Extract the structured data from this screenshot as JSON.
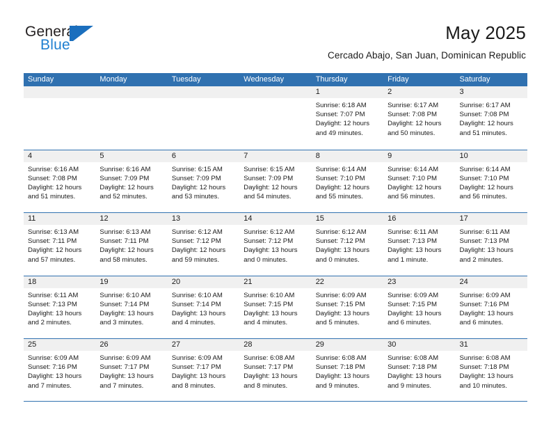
{
  "brand": {
    "name_part1": "General",
    "name_part2": "Blue",
    "logo_icon": "general-blue-triangle-logo"
  },
  "header": {
    "title": "May 2025",
    "subtitle": "Cercado Abajo, San Juan, Dominican Republic"
  },
  "colors": {
    "header_blue": "#3071b0",
    "brand_blue": "#1f7fd0",
    "day_band_gray": "#f0f0f0",
    "text": "#1a1a1a"
  },
  "calendar": {
    "weekday_headers": [
      "Sunday",
      "Monday",
      "Tuesday",
      "Wednesday",
      "Thursday",
      "Friday",
      "Saturday"
    ],
    "weeks": [
      [
        {
          "day": "",
          "empty": true,
          "sunrise": "",
          "sunset": "",
          "daylight_line1": "",
          "daylight_line2": ""
        },
        {
          "day": "",
          "empty": true,
          "sunrise": "",
          "sunset": "",
          "daylight_line1": "",
          "daylight_line2": ""
        },
        {
          "day": "",
          "empty": true,
          "sunrise": "",
          "sunset": "",
          "daylight_line1": "",
          "daylight_line2": ""
        },
        {
          "day": "",
          "empty": true,
          "sunrise": "",
          "sunset": "",
          "daylight_line1": "",
          "daylight_line2": ""
        },
        {
          "day": "1",
          "empty": false,
          "sunrise": "Sunrise: 6:18 AM",
          "sunset": "Sunset: 7:07 PM",
          "daylight_line1": "Daylight: 12 hours",
          "daylight_line2": "and 49 minutes."
        },
        {
          "day": "2",
          "empty": false,
          "sunrise": "Sunrise: 6:17 AM",
          "sunset": "Sunset: 7:08 PM",
          "daylight_line1": "Daylight: 12 hours",
          "daylight_line2": "and 50 minutes."
        },
        {
          "day": "3",
          "empty": false,
          "sunrise": "Sunrise: 6:17 AM",
          "sunset": "Sunset: 7:08 PM",
          "daylight_line1": "Daylight: 12 hours",
          "daylight_line2": "and 51 minutes."
        }
      ],
      [
        {
          "day": "4",
          "empty": false,
          "sunrise": "Sunrise: 6:16 AM",
          "sunset": "Sunset: 7:08 PM",
          "daylight_line1": "Daylight: 12 hours",
          "daylight_line2": "and 51 minutes."
        },
        {
          "day": "5",
          "empty": false,
          "sunrise": "Sunrise: 6:16 AM",
          "sunset": "Sunset: 7:09 PM",
          "daylight_line1": "Daylight: 12 hours",
          "daylight_line2": "and 52 minutes."
        },
        {
          "day": "6",
          "empty": false,
          "sunrise": "Sunrise: 6:15 AM",
          "sunset": "Sunset: 7:09 PM",
          "daylight_line1": "Daylight: 12 hours",
          "daylight_line2": "and 53 minutes."
        },
        {
          "day": "7",
          "empty": false,
          "sunrise": "Sunrise: 6:15 AM",
          "sunset": "Sunset: 7:09 PM",
          "daylight_line1": "Daylight: 12 hours",
          "daylight_line2": "and 54 minutes."
        },
        {
          "day": "8",
          "empty": false,
          "sunrise": "Sunrise: 6:14 AM",
          "sunset": "Sunset: 7:10 PM",
          "daylight_line1": "Daylight: 12 hours",
          "daylight_line2": "and 55 minutes."
        },
        {
          "day": "9",
          "empty": false,
          "sunrise": "Sunrise: 6:14 AM",
          "sunset": "Sunset: 7:10 PM",
          "daylight_line1": "Daylight: 12 hours",
          "daylight_line2": "and 56 minutes."
        },
        {
          "day": "10",
          "empty": false,
          "sunrise": "Sunrise: 6:14 AM",
          "sunset": "Sunset: 7:10 PM",
          "daylight_line1": "Daylight: 12 hours",
          "daylight_line2": "and 56 minutes."
        }
      ],
      [
        {
          "day": "11",
          "empty": false,
          "sunrise": "Sunrise: 6:13 AM",
          "sunset": "Sunset: 7:11 PM",
          "daylight_line1": "Daylight: 12 hours",
          "daylight_line2": "and 57 minutes."
        },
        {
          "day": "12",
          "empty": false,
          "sunrise": "Sunrise: 6:13 AM",
          "sunset": "Sunset: 7:11 PM",
          "daylight_line1": "Daylight: 12 hours",
          "daylight_line2": "and 58 minutes."
        },
        {
          "day": "13",
          "empty": false,
          "sunrise": "Sunrise: 6:12 AM",
          "sunset": "Sunset: 7:12 PM",
          "daylight_line1": "Daylight: 12 hours",
          "daylight_line2": "and 59 minutes."
        },
        {
          "day": "14",
          "empty": false,
          "sunrise": "Sunrise: 6:12 AM",
          "sunset": "Sunset: 7:12 PM",
          "daylight_line1": "Daylight: 13 hours",
          "daylight_line2": "and 0 minutes."
        },
        {
          "day": "15",
          "empty": false,
          "sunrise": "Sunrise: 6:12 AM",
          "sunset": "Sunset: 7:12 PM",
          "daylight_line1": "Daylight: 13 hours",
          "daylight_line2": "and 0 minutes."
        },
        {
          "day": "16",
          "empty": false,
          "sunrise": "Sunrise: 6:11 AM",
          "sunset": "Sunset: 7:13 PM",
          "daylight_line1": "Daylight: 13 hours",
          "daylight_line2": "and 1 minute."
        },
        {
          "day": "17",
          "empty": false,
          "sunrise": "Sunrise: 6:11 AM",
          "sunset": "Sunset: 7:13 PM",
          "daylight_line1": "Daylight: 13 hours",
          "daylight_line2": "and 2 minutes."
        }
      ],
      [
        {
          "day": "18",
          "empty": false,
          "sunrise": "Sunrise: 6:11 AM",
          "sunset": "Sunset: 7:13 PM",
          "daylight_line1": "Daylight: 13 hours",
          "daylight_line2": "and 2 minutes."
        },
        {
          "day": "19",
          "empty": false,
          "sunrise": "Sunrise: 6:10 AM",
          "sunset": "Sunset: 7:14 PM",
          "daylight_line1": "Daylight: 13 hours",
          "daylight_line2": "and 3 minutes."
        },
        {
          "day": "20",
          "empty": false,
          "sunrise": "Sunrise: 6:10 AM",
          "sunset": "Sunset: 7:14 PM",
          "daylight_line1": "Daylight: 13 hours",
          "daylight_line2": "and 4 minutes."
        },
        {
          "day": "21",
          "empty": false,
          "sunrise": "Sunrise: 6:10 AM",
          "sunset": "Sunset: 7:15 PM",
          "daylight_line1": "Daylight: 13 hours",
          "daylight_line2": "and 4 minutes."
        },
        {
          "day": "22",
          "empty": false,
          "sunrise": "Sunrise: 6:09 AM",
          "sunset": "Sunset: 7:15 PM",
          "daylight_line1": "Daylight: 13 hours",
          "daylight_line2": "and 5 minutes."
        },
        {
          "day": "23",
          "empty": false,
          "sunrise": "Sunrise: 6:09 AM",
          "sunset": "Sunset: 7:15 PM",
          "daylight_line1": "Daylight: 13 hours",
          "daylight_line2": "and 6 minutes."
        },
        {
          "day": "24",
          "empty": false,
          "sunrise": "Sunrise: 6:09 AM",
          "sunset": "Sunset: 7:16 PM",
          "daylight_line1": "Daylight: 13 hours",
          "daylight_line2": "and 6 minutes."
        }
      ],
      [
        {
          "day": "25",
          "empty": false,
          "sunrise": "Sunrise: 6:09 AM",
          "sunset": "Sunset: 7:16 PM",
          "daylight_line1": "Daylight: 13 hours",
          "daylight_line2": "and 7 minutes."
        },
        {
          "day": "26",
          "empty": false,
          "sunrise": "Sunrise: 6:09 AM",
          "sunset": "Sunset: 7:17 PM",
          "daylight_line1": "Daylight: 13 hours",
          "daylight_line2": "and 7 minutes."
        },
        {
          "day": "27",
          "empty": false,
          "sunrise": "Sunrise: 6:09 AM",
          "sunset": "Sunset: 7:17 PM",
          "daylight_line1": "Daylight: 13 hours",
          "daylight_line2": "and 8 minutes."
        },
        {
          "day": "28",
          "empty": false,
          "sunrise": "Sunrise: 6:08 AM",
          "sunset": "Sunset: 7:17 PM",
          "daylight_line1": "Daylight: 13 hours",
          "daylight_line2": "and 8 minutes."
        },
        {
          "day": "29",
          "empty": false,
          "sunrise": "Sunrise: 6:08 AM",
          "sunset": "Sunset: 7:18 PM",
          "daylight_line1": "Daylight: 13 hours",
          "daylight_line2": "and 9 minutes."
        },
        {
          "day": "30",
          "empty": false,
          "sunrise": "Sunrise: 6:08 AM",
          "sunset": "Sunset: 7:18 PM",
          "daylight_line1": "Daylight: 13 hours",
          "daylight_line2": "and 9 minutes."
        },
        {
          "day": "31",
          "empty": false,
          "sunrise": "Sunrise: 6:08 AM",
          "sunset": "Sunset: 7:18 PM",
          "daylight_line1": "Daylight: 13 hours",
          "daylight_line2": "and 10 minutes."
        }
      ]
    ]
  }
}
